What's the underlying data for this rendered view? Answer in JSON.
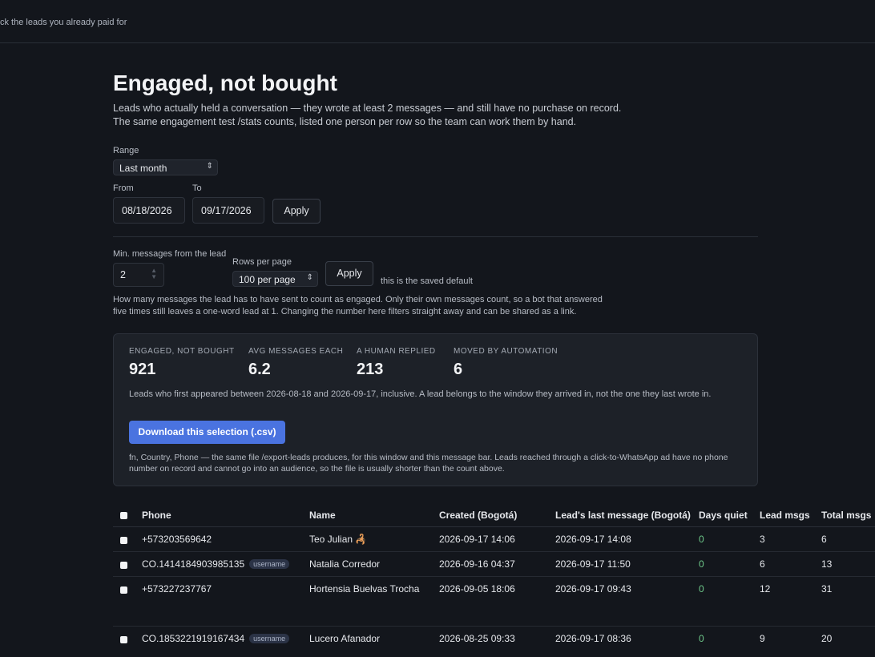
{
  "topbar": {
    "crumb": "ck the leads you already paid for"
  },
  "page": {
    "title": "Engaged, not bought",
    "intro_line1": "Leads who actually held a conversation — they wrote at least 2 messages — and still have no purchase on record.",
    "intro_line2": "The same engagement test /stats counts, listed one person per row so the team can work them by hand."
  },
  "range": {
    "label": "Range",
    "selected": "Last month",
    "from_label": "From",
    "to_label": "To",
    "from_value": "08/18/2026",
    "to_value": "09/17/2026",
    "apply_label": "Apply"
  },
  "filters": {
    "min_label": "Min. messages from the lead",
    "min_value": "2",
    "rows_label": "Rows per page",
    "rows_selected": "100 per page",
    "apply_label": "Apply",
    "saved_note": "this is the saved default",
    "help_line1": "How many messages the lead has to have sent to count as engaged. Only their own messages count, so a bot that answered",
    "help_line2": "five times still leaves a one-word lead at 1. Changing the number here filters straight away and can be shared as a link."
  },
  "stats": {
    "kpis": [
      {
        "label": "ENGAGED, NOT BOUGHT",
        "value": "921"
      },
      {
        "label": "AVG MESSAGES EACH",
        "value": "6.2"
      },
      {
        "label": "A HUMAN REPLIED",
        "value": "213"
      },
      {
        "label": "MOVED BY AUTOMATION",
        "value": "6"
      }
    ],
    "desc": "Leads who first appeared between 2026-08-18 and 2026-09-17, inclusive. A lead belongs to the window they arrived in, not the one they last wrote in.",
    "download_label": "Download this selection (.csv)",
    "foot": "fn, Country, Phone — the same file /export-leads produces, for this window and this message bar. Leads reached through a click-to-WhatsApp ad have no phone number on record and cannot go into an audience, so the file is usually shorter than the count above."
  },
  "table": {
    "headers": [
      "Phone",
      "Name",
      "Created (Bogotá)",
      "Lead's last message (Bogotá)",
      "Days quiet",
      "Lead msgs",
      "Total msgs"
    ],
    "rows": [
      {
        "phone": "+573203569642",
        "tag": "",
        "name": "Teo Julian 🦂",
        "created": "2026-09-17 14:06",
        "last": "2026-09-17 14:08",
        "quiet": "0",
        "lead_msgs": "3",
        "total": "6"
      },
      {
        "phone": "CO.1414184903985135",
        "tag": "username",
        "name": "Natalia Corredor",
        "created": "2026-09-16 04:37",
        "last": "2026-09-17 11:50",
        "quiet": "0",
        "lead_msgs": "6",
        "total": "13"
      },
      {
        "phone": "+573227237767",
        "tag": "",
        "name": "Hortensia Buelvas Trocha",
        "created": "2026-09-05 18:06",
        "last": "2026-09-17 09:43",
        "quiet": "0",
        "lead_msgs": "12",
        "total": "31"
      },
      {
        "phone": "CO.1853221919167434",
        "tag": "username",
        "name": "Lucero Afanador",
        "created": "2026-08-25 09:33",
        "last": "2026-09-17 08:36",
        "quiet": "0",
        "lead_msgs": "9",
        "total": "20"
      }
    ]
  }
}
